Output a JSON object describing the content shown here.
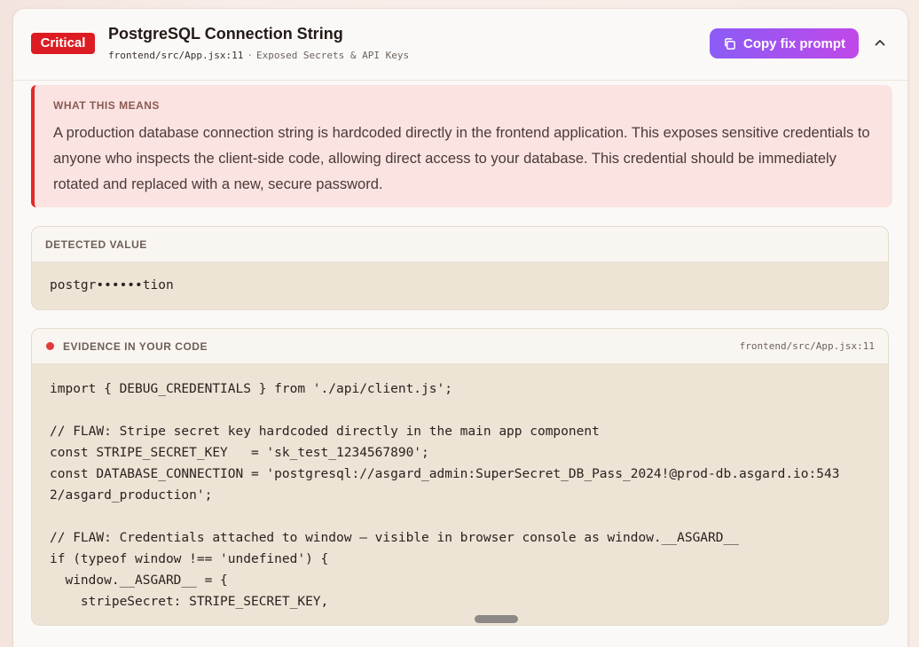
{
  "header": {
    "severity": "Critical",
    "title": "PostgreSQL Connection String",
    "file": "frontend/src/App.jsx:11",
    "separator": "·",
    "category": "Exposed Secrets & API Keys",
    "copy_label": "Copy fix prompt"
  },
  "meaning": {
    "label": "WHAT THIS MEANS",
    "body": "A production database connection string is hardcoded directly in the frontend application. This exposes sensitive credentials to anyone who inspects the client-side code, allowing direct access to your database. This credential should be immediately rotated and replaced with a new, secure password."
  },
  "detected": {
    "label": "DETECTED VALUE",
    "value": "postgr••••••tion"
  },
  "evidence": {
    "label": "EVIDENCE IN YOUR CODE",
    "path": "frontend/src/App.jsx:11",
    "lines": [
      "import { DEBUG_CREDENTIALS } from './api/client.js';",
      "",
      "// FLAW: Stripe secret key hardcoded directly in the main app component",
      "const STRIPE_SECRET_KEY   = 'sk_test_1234567890';",
      "const DATABASE_CONNECTION = 'postgresql://asgard_admin:SuperSecret_DB_Pass_2024!@prod-db.asgard.io:543",
      "2/asgard_production';",
      "",
      "// FLAW: Credentials attached to window — visible in browser console as window.__ASGARD__",
      "if (typeof window !== 'undefined') {",
      "  window.__ASGARD__ = {",
      "    stripeSecret: STRIPE_SECRET_KEY,"
    ]
  },
  "colors": {
    "critical": "#dc1c22",
    "accent_start": "#8b5cf6",
    "accent_end": "#c048e8",
    "alert_bg": "#fbe3e2"
  },
  "icons": {
    "copy": "copy-icon",
    "collapse": "chevron-up-icon"
  }
}
